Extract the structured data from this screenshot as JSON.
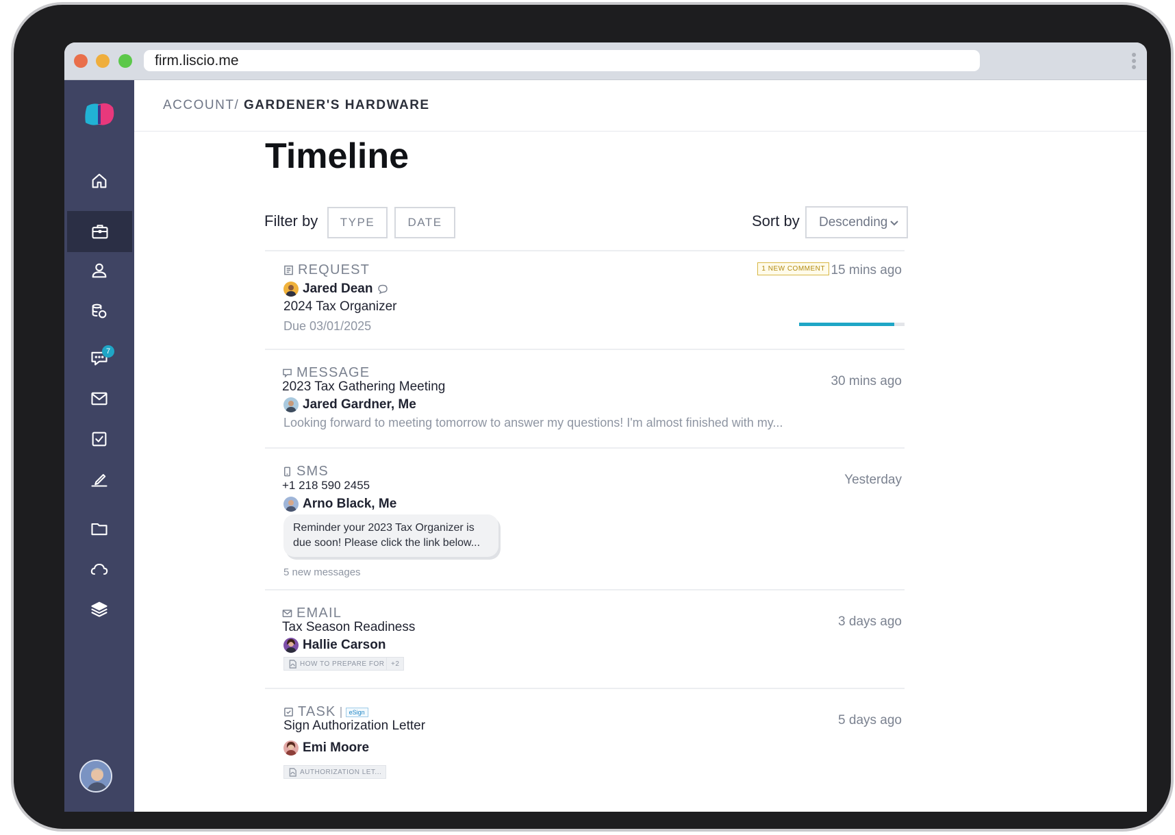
{
  "browser": {
    "url": "firm.liscio.me"
  },
  "sidebar": {
    "items": [
      {
        "name": "home-icon"
      },
      {
        "name": "briefcase-icon",
        "active": true
      },
      {
        "name": "user-icon"
      },
      {
        "name": "billing-icon"
      },
      {
        "name": "chat-icon",
        "badge": "7"
      },
      {
        "name": "mail-icon"
      },
      {
        "name": "task-check-icon"
      },
      {
        "name": "signature-icon"
      },
      {
        "name": "folder-icon"
      },
      {
        "name": "cloud-icon"
      },
      {
        "name": "layers-icon"
      }
    ]
  },
  "header": {
    "breadcrumb_root": "ACCOUNT/",
    "breadcrumb_current": "GARDENER'S HARDWARE"
  },
  "page": {
    "title": "Timeline"
  },
  "filters": {
    "label": "Filter by",
    "type_label": "TYPE",
    "date_label": "DATE",
    "sort_label": "Sort by",
    "sort_value": "Descending"
  },
  "entries": [
    {
      "type": "REQUEST",
      "time": "15 mins ago",
      "badge": "1 NEW COMMENT",
      "person": "Jared Dean",
      "subject": "2024 Tax Organizer",
      "meta": "Due 03/01/2025",
      "progress": 0.9
    },
    {
      "type": "MESSAGE",
      "time": "30 mins ago",
      "subject": "2023 Tax Gathering Meeting",
      "person": "Jared Gardner, Me",
      "meta": "Looking forward to meeting tomorrow to answer my questions! I'm almost finished with my..."
    },
    {
      "type": "SMS",
      "time": "Yesterday",
      "subject": "+1 218 590 2455",
      "person": "Arno Black, Me",
      "bubble": "Reminder your 2023 Tax Organizer is due soon! Please click the link below...",
      "meta": "5 new messages"
    },
    {
      "type": "EMAIL",
      "time": "3 days ago",
      "subject": "Tax Season Readiness",
      "person": "Hallie Carson",
      "attachment": "HOW TO PREPARE FOR",
      "attachment_more": "+2"
    },
    {
      "type": "TASK",
      "tag": "eSign",
      "time": "5 days ago",
      "subject": "Sign Authorization Letter",
      "person": "Emi Moore",
      "attachment": "AUTHORIZATION LET..."
    }
  ]
}
